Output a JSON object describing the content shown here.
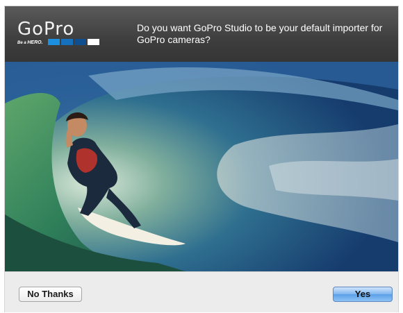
{
  "header": {
    "logo_text": "GoPro",
    "tagline_prefix": "Be a ",
    "tagline_hero": "HERO.",
    "logo_squares": [
      "#1b8fe0",
      "#1670bd",
      "#0f4f8f",
      "#ffffff"
    ],
    "question": "Do you want GoPro Studio to be your default importer for GoPro cameras?"
  },
  "photo": {
    "icon": "surfer-in-wave-photo"
  },
  "footer": {
    "no_label": "No Thanks",
    "yes_label": "Yes"
  },
  "colors": {
    "header_bg": "#444444",
    "footer_bg": "#ececec",
    "default_button": "#6aa9ee"
  }
}
